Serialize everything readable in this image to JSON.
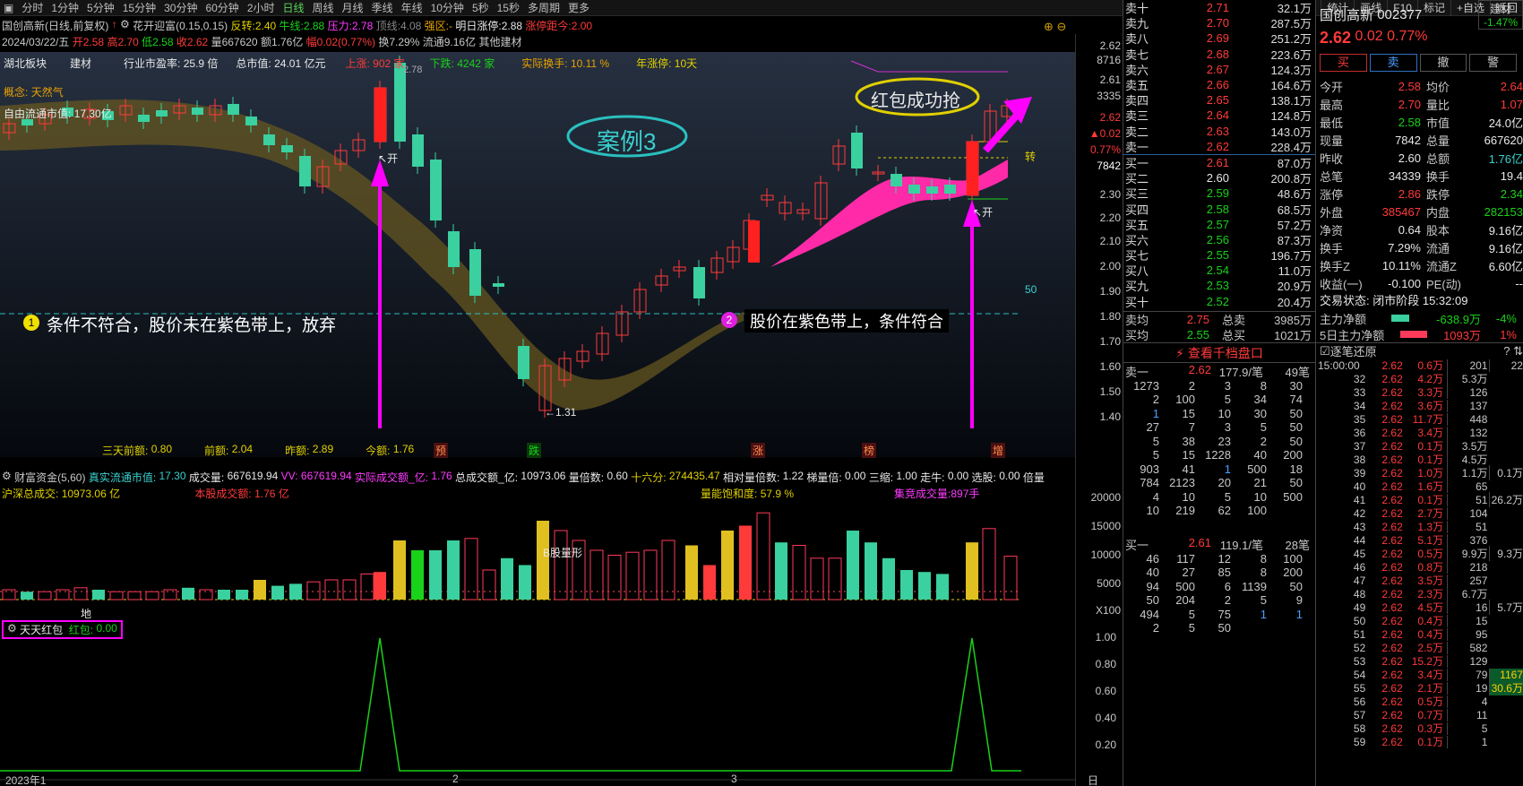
{
  "toolbar": {
    "periods": [
      "分时",
      "1分钟",
      "5分钟",
      "15分钟",
      "30分钟",
      "60分钟",
      "2小时",
      "日线",
      "周线",
      "月线",
      "季线",
      "年线",
      "10分钟",
      "5秒",
      "15秒",
      "多周期",
      "更多"
    ],
    "active": "日线",
    "right": [
      "复权",
      "叠加",
      "多股",
      "统计",
      "画线",
      "F10",
      "标记",
      "+自选",
      "返回"
    ]
  },
  "info1": {
    "title": "国创高新(日线,前复权)",
    "ind": "花开迎富(0.15,0.15)",
    "fz_l": "反转:",
    "fz": "2.40",
    "nx_l": "牛线:",
    "nx": "2.88",
    "yl_l": "压力:",
    "yl": "2.78",
    "dx_l": "顶线:",
    "dx": "4.08",
    "qr_l": "强区:",
    "qr": "-",
    "mr_l": "明日涨停:",
    "mr": "2.88",
    "zt_l": "涨停距今:",
    "zt": "2.00"
  },
  "info2": {
    "date": "2024/03/22/五",
    "open": "开2.58",
    "high": "高2.70",
    "low": "低2.58",
    "close": "收2.62",
    "vol": "量667620",
    "amt": "额1.76亿",
    "pct": "幅0.02(0.77%)",
    "turn": "换7.29%",
    "float": "流通9.16亿",
    "other": "其他建材"
  },
  "chart_header": {
    "region": "湖北板块",
    "sector": "建材",
    "pe_l": "行业市盈率:",
    "pe": "25.9 倍",
    "mv_l": "总市值:",
    "mv": "24.01 亿元",
    "up_l": "上涨:",
    "up": "902 家",
    "dn_l": "下跌:",
    "dn": "4242 家",
    "hs_l": "实际换手:",
    "hs": "10.11 %",
    "yz_l": "年涨停:",
    "yz": "10天"
  },
  "concept": {
    "label": "概念:",
    "value": "天然气"
  },
  "free_float": {
    "label": "自由流通市值:",
    "value": "17.30亿"
  },
  "annotations": {
    "case": "案例3",
    "success": "红包成功抢",
    "note1_num": "1",
    "note1": "条件不符合，股价未在紫色带上，放弃",
    "note2_num": "2",
    "note2": "股价在紫色带上，条件符合",
    "kai1": "开",
    "kai2": "开",
    "low_mark": "←1.31",
    "peak": "2.78",
    "zhuan": "转",
    "line50": "50"
  },
  "bottom_labels": {
    "sanqian_l": "三天前额:",
    "sanqian": "0.80",
    "qian_l": "前额:",
    "qian": "2.04",
    "zuo_l": "昨额:",
    "zuo": "2.89",
    "jin_l": "今额:",
    "jin": "1.76",
    "tags": [
      "预",
      "跌",
      "涨",
      "榜",
      "增"
    ]
  },
  "price_axis": [
    "2.62",
    "8716",
    "2.61",
    "3335",
    "2.62",
    "▲0.02",
    "0.77%",
    "7842",
    "2.30",
    "2.20",
    "2.10",
    "2.00",
    "1.90",
    "1.80",
    "1.70",
    "1.60",
    "1.50",
    "1.40"
  ],
  "vol_header": {
    "name": "财富资金(5,60)",
    "zs_l": "真实流通市值:",
    "zs": "17.30",
    "cj_l": "成交量:",
    "cj": "667619.94",
    "vv_l": "VV:",
    "vv": "667619.94",
    "sj_l": "实际成交额_亿:",
    "sj": "1.76",
    "zcj_l": "总成交额_亿:",
    "zcj": "10973.06",
    "lbs_l": "量倍数:",
    "lbs": "0.60",
    "slf_l": "十六分:",
    "slf": "274435.47",
    "xd_l": "相对量倍数:",
    "xd": "1.22",
    "tl_l": "梯量倍:",
    "tl": "0.00",
    "sz_l": "三缩:",
    "sz": "1.00",
    "zn_l": "走牛:",
    "zn": "0.00",
    "xg_l": "选股:",
    "xg": "0.00",
    "bs_l": "倍量"
  },
  "vol_line2": {
    "hs_l": "沪深总成交:",
    "hs": "10973.06 亿",
    "bg_l": "本股成交额:",
    "bg": "1.76 亿",
    "bh_l": "量能饱和度:",
    "bh": "57.9 %",
    "jj_l": "集竞成交量:",
    "jj": "897手"
  },
  "vol_axis": [
    "20000",
    "15000",
    "10000",
    "5000",
    "X100"
  ],
  "vol_marks": {
    "gly": "B股量形",
    "di": "地"
  },
  "hongbao": {
    "name": "天天红包",
    "label": "红包:",
    "value": "0.00"
  },
  "hb_axis": [
    "1.00",
    "0.80",
    "0.60",
    "0.40",
    "0.20"
  ],
  "time_axis": [
    "2023年1",
    "2",
    "3",
    "日线"
  ],
  "orderbook_sell": [
    [
      "卖十",
      "2.71",
      "32.1万"
    ],
    [
      "卖九",
      "2.70",
      "287.5万"
    ],
    [
      "卖八",
      "2.69",
      "251.2万"
    ],
    [
      "卖七",
      "2.68",
      "223.6万"
    ],
    [
      "卖六",
      "2.67",
      "124.3万"
    ],
    [
      "卖五",
      "2.66",
      "164.6万"
    ],
    [
      "卖四",
      "2.65",
      "138.1万"
    ],
    [
      "卖三",
      "2.64",
      "124.8万"
    ],
    [
      "卖二",
      "2.63",
      "143.0万"
    ],
    [
      "卖一",
      "2.62",
      "228.4万"
    ]
  ],
  "orderbook_buy": [
    [
      "买一",
      "2.61",
      "87.0万"
    ],
    [
      "买二",
      "2.60",
      "200.8万"
    ],
    [
      "买三",
      "2.59",
      "48.6万"
    ],
    [
      "买四",
      "2.58",
      "68.5万"
    ],
    [
      "买五",
      "2.57",
      "57.2万"
    ],
    [
      "买六",
      "2.56",
      "87.3万"
    ],
    [
      "买七",
      "2.55",
      "196.7万"
    ],
    [
      "买八",
      "2.54",
      "11.0万"
    ],
    [
      "买九",
      "2.53",
      "20.9万"
    ],
    [
      "买十",
      "2.52",
      "20.4万"
    ]
  ],
  "avg": {
    "s_l": "卖均",
    "s": "2.75",
    "sv_l": "总卖",
    "sv": "3985万",
    "b_l": "买均",
    "b": "2.55",
    "bv_l": "总买",
    "bv": "1021万"
  },
  "qiandang": "查看千档盘口",
  "mai1_head": [
    "卖一",
    "2.62",
    "177.9/笔",
    "49笔"
  ],
  "mai1_rows": [
    [
      "1273",
      "2",
      "3",
      "8",
      "30"
    ],
    [
      "2",
      "100",
      "5",
      "34",
      "74"
    ],
    [
      "1",
      "15",
      "10",
      "30",
      "50"
    ],
    [
      "27",
      "7",
      "3",
      "5",
      "50"
    ],
    [
      "5",
      "38",
      "23",
      "2",
      "50"
    ],
    [
      "5",
      "15",
      "1228",
      "40",
      "200"
    ],
    [
      "903",
      "41",
      "1",
      "500",
      "18"
    ],
    [
      "784",
      "2123",
      "20",
      "21",
      "50"
    ],
    [
      "4",
      "10",
      "5",
      "10",
      "500"
    ],
    [
      "10",
      "219",
      "62",
      "100",
      ""
    ]
  ],
  "buy1_head": [
    "买一",
    "2.61",
    "119.1/笔",
    "28笔"
  ],
  "buy1_rows": [
    [
      "46",
      "117",
      "12",
      "8",
      "100"
    ],
    [
      "40",
      "27",
      "85",
      "8",
      "200"
    ],
    [
      "94",
      "500",
      "6",
      "1139",
      "50"
    ],
    [
      "50",
      "204",
      "2",
      "5",
      "9"
    ],
    [
      "494",
      "5",
      "75",
      "1",
      "1"
    ],
    [
      "2",
      "5",
      "50",
      "",
      ""
    ]
  ],
  "stock": {
    "name": "国创高新",
    "code": "002377",
    "price": "2.62",
    "chg": "0.02",
    "pct": "0.77%",
    "side": "建材",
    "side_pct": "-1.47%"
  },
  "actions": [
    "买",
    "卖",
    "撤",
    "警"
  ],
  "quote": [
    [
      "今开",
      "2.58",
      "均价",
      "2.64"
    ],
    [
      "最高",
      "2.70",
      "量比",
      "1.07"
    ],
    [
      "最低",
      "2.58",
      "市值",
      "24.0亿"
    ],
    [
      "现量",
      "7842",
      "总量",
      "667620"
    ],
    [
      "昨收",
      "2.60",
      "总额",
      "1.76亿"
    ],
    [
      "总笔",
      "34339",
      "换手",
      "19.4"
    ],
    [
      "涨停",
      "2.86",
      "跌停",
      "2.34"
    ],
    [
      "外盘",
      "385467",
      "内盘",
      "282153"
    ],
    [
      "净资",
      "0.64",
      "股本",
      "9.16亿"
    ],
    [
      "换手",
      "7.29%",
      "流通",
      "9.16亿"
    ],
    [
      "换手Z",
      "10.11%",
      "流通Z",
      "6.60亿"
    ],
    [
      "收益(一)",
      "-0.100",
      "PE(动)",
      "--"
    ]
  ],
  "trade_stage": "交易状态: 闭市阶段 15:32:09",
  "main_net": {
    "l": "主力净额",
    "v": "-638.9万",
    "p": "-4%"
  },
  "net5": {
    "l": "5日主力净额",
    "v": "1093万",
    "p": "1%"
  },
  "ticks_title": "逐笔还原",
  "ticks": [
    [
      "15:00:00",
      "2.62",
      "0.6万"
    ],
    [
      "32",
      "2.62",
      "4.2万"
    ],
    [
      "33",
      "2.62",
      "3.3万"
    ],
    [
      "34",
      "2.62",
      "3.6万"
    ],
    [
      "35",
      "2.62",
      "11.7万"
    ],
    [
      "36",
      "2.62",
      "3.4万"
    ],
    [
      "37",
      "2.62",
      "0.1万"
    ],
    [
      "38",
      "2.62",
      "0.1万"
    ],
    [
      "39",
      "2.62",
      "1.0万"
    ],
    [
      "40",
      "2.62",
      "1.6万"
    ],
    [
      "41",
      "2.62",
      "0.1万"
    ],
    [
      "42",
      "2.62",
      "2.7万"
    ],
    [
      "43",
      "2.62",
      "1.3万"
    ],
    [
      "44",
      "2.62",
      "5.1万"
    ],
    [
      "45",
      "2.62",
      "0.5万"
    ],
    [
      "46",
      "2.62",
      "0.8万"
    ],
    [
      "47",
      "2.62",
      "3.5万"
    ],
    [
      "48",
      "2.62",
      "2.3万"
    ],
    [
      "49",
      "2.62",
      "4.5万"
    ],
    [
      "50",
      "2.62",
      "0.4万"
    ],
    [
      "51",
      "2.62",
      "0.4万"
    ],
    [
      "52",
      "2.62",
      "2.5万"
    ],
    [
      "53",
      "2.62",
      "15.2万"
    ],
    [
      "54",
      "2.62",
      "3.4万"
    ],
    [
      "55",
      "2.62",
      "2.1万"
    ],
    [
      "56",
      "2.62",
      "0.5万"
    ],
    [
      "57",
      "2.62",
      "0.7万"
    ],
    [
      "58",
      "2.62",
      "0.3万"
    ],
    [
      "59",
      "2.62",
      "0.1万"
    ]
  ],
  "ticks_r1": [
    "201",
    "5.3万",
    "126",
    "137",
    "448",
    "132",
    "3.5万",
    "4.5万",
    "1.1万",
    "65",
    "51",
    "104",
    "51",
    "376",
    "9.9万",
    "218",
    "257",
    "6.7万",
    "16",
    "15",
    "95",
    "582",
    "129",
    "79",
    "19",
    "4",
    "11",
    "5",
    "1"
  ],
  "ticks_r2": [
    "22",
    "",
    "",
    "",
    "",
    "",
    "",
    "",
    "0.1万",
    "",
    "26.2万",
    "",
    "",
    "",
    "9.3万",
    "",
    "",
    "",
    "5.7万",
    "",
    "",
    "",
    "",
    "1167",
    "30.6万",
    "",
    "",
    "",
    ""
  ],
  "colors": {
    "up": "#ff3a3a",
    "down": "#19d219",
    "magenta": "#ff00ff",
    "band": "#6a5a20"
  }
}
